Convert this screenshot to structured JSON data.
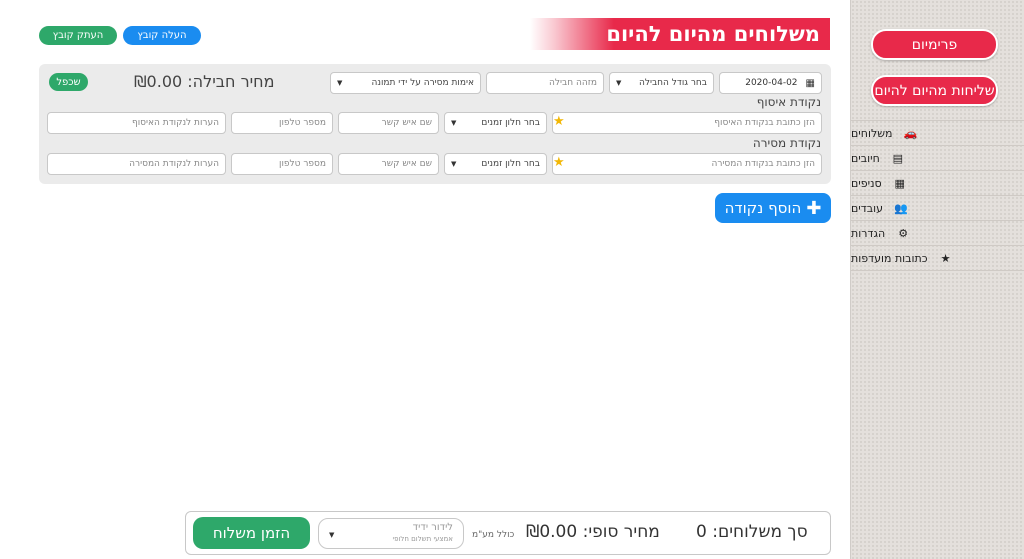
{
  "sidebar": {
    "premium_button": "פרימיום",
    "today_button": "שליחות מהיום להיום",
    "items": [
      {
        "label": "משלוחים",
        "icon": "🚗"
      },
      {
        "label": "חיובים",
        "icon": "▤"
      },
      {
        "label": "סניפים",
        "icon": "▦"
      },
      {
        "label": "עובדים",
        "icon": "👥"
      },
      {
        "label": "הגדרות",
        "icon": "⚙"
      },
      {
        "label": "כתובות מועדפות",
        "icon": "★"
      }
    ]
  },
  "header": {
    "title": "משלוחים מהיום להיום",
    "upload_button": "העלה קובץ",
    "copy_button": "העתק קובץ"
  },
  "form": {
    "date_value": "2020-04-02",
    "package_size_select": "בחר גודל החבילה",
    "package_id_placeholder": "מזהה חבילה",
    "delivery_verify_select": "אימות מסירה על ידי תמונה",
    "price_label": "מחיר חבילה: ₪0.00",
    "forgot_button": "שכפל",
    "pickup": {
      "label": "נקודת איסוף",
      "address_placeholder": "הזן כתובת בנקודת האיסוף",
      "window_select": "בחר חלון זמנים",
      "contact_placeholder": "שם איש קשר",
      "phone_placeholder": "מספר טלפון",
      "notes_placeholder": "הערות לנקודת האיסוף"
    },
    "dropoff": {
      "label": "נקודת מסירה",
      "address_placeholder": "הזן כתובת בנקודת המסירה",
      "window_select": "בחר חלון זמנים",
      "contact_placeholder": "שם איש קשר",
      "phone_placeholder": "מספר טלפון",
      "notes_placeholder": "הערות לנקודת המסירה"
    }
  },
  "add_point_button": "הוסף נקודה",
  "footer": {
    "total_deliveries": "סך משלוחים: 0",
    "final_price": "מחיר סופי: ₪0.00",
    "vat_note": "כולל מע\"מ",
    "payment_select_main": "לידור ידיד",
    "payment_select_sub": "אמצעי תשלום חלופי",
    "order_button": "הזמן משלוח"
  }
}
